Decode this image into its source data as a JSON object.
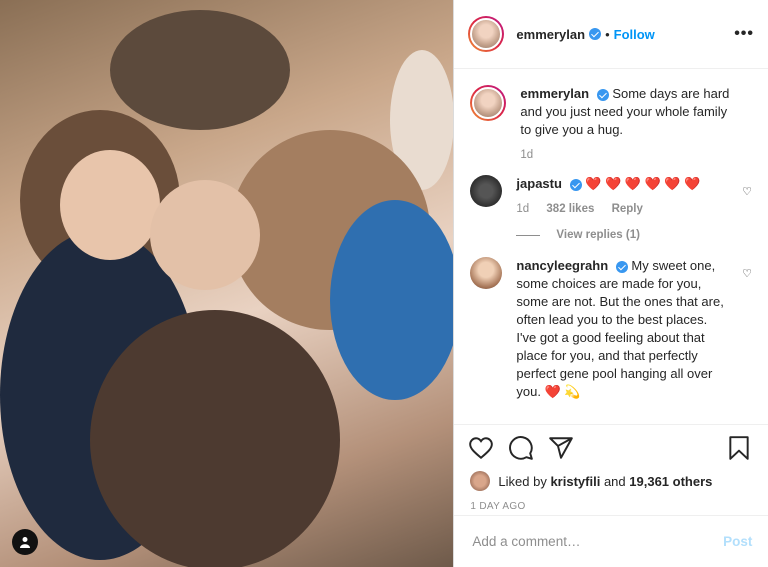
{
  "post": {
    "username": "emmerylan",
    "follow_label": "Follow",
    "more_icon": "ellipsis-icon",
    "caption": "Some days are hard and you just need your whole family to give you a hug.",
    "caption_age": "1d"
  },
  "comments": [
    {
      "username": "japastu",
      "text": "❤️ ❤️ ❤️ ❤️ ❤️ ❤️",
      "age": "1d",
      "likes": "382 likes",
      "reply_label": "Reply",
      "view_replies": "View replies (1)"
    },
    {
      "username": "nancyleegrahn",
      "text": "My sweet one, some choices are made for you, some are not. But the ones that are, often lead you to the best places. I've got a good feeling about that place for you, and that perfectly perfect gene pool hanging all over you. ❤️ 💫"
    }
  ],
  "actions": {
    "like_icon": "heart-icon",
    "comment_icon": "comment-icon",
    "share_icon": "share-icon",
    "save_icon": "bookmark-icon"
  },
  "likes": {
    "prefix": "Liked by",
    "user": "kristyfili",
    "and_label": "and",
    "others": "19,361 others"
  },
  "timestamp": "1 DAY AGO",
  "comment_box": {
    "placeholder": "Add a comment…",
    "post_label": "Post"
  },
  "colors": {
    "accent": "#0095f6",
    "verified": "#3897f0",
    "heart": "#ed4956"
  }
}
